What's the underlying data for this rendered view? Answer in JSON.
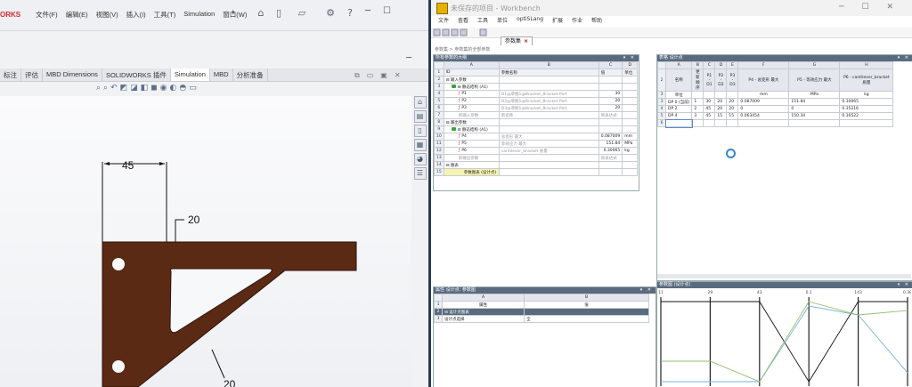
{
  "solidworks": {
    "brand": "ORKS",
    "menu": [
      "文件(F)",
      "编辑(E)",
      "视图(V)",
      "插入(I)",
      "工具(T)",
      "Simulation",
      "窗口(W)"
    ],
    "tabs": [
      "标注",
      "评估",
      "MBD Dimensions",
      "SOLIDWORKS 插件",
      "Simulation",
      "MBD",
      "分析准备"
    ],
    "active_tab": "Simulation",
    "dimensions": {
      "top_width": "45",
      "thickness_top": "20",
      "thickness_bottom": "20"
    },
    "part_color": "#5a2a14"
  },
  "workbench": {
    "title": "未保存的项目 - Workbench",
    "menu": [
      "文件",
      "查看",
      "工具",
      "单位",
      "optiSLang",
      "扩展",
      "作业",
      "帮助"
    ],
    "active_tab": "参数集",
    "breadcrumb": "参数集 > 参数集的全部参数",
    "outline": {
      "title": "所有参数的大纲",
      "col_letters": [
        "A",
        "B",
        "C",
        "D"
      ],
      "rows": [
        {
          "n": "1",
          "a": "ID",
          "b": "参数名称",
          "c": "值",
          "d": "单位"
        },
        {
          "n": "2",
          "a": "⊟  输入参数",
          "b": "",
          "c": "",
          "d": ""
        },
        {
          "n": "3",
          "a": "⊟  静态结构 (A1)",
          "b": "",
          "c": "",
          "d": "",
          "folder": true
        },
        {
          "n": "4",
          "a": "P1",
          "b": "D1@草图1@Bracket_Bracket.Part",
          "c": "30",
          "d": "",
          "param": true
        },
        {
          "n": "5",
          "a": "P2",
          "b": "D2@草图1@Bracket_Bracket.Part",
          "c": "20",
          "d": "",
          "param": true
        },
        {
          "n": "6",
          "a": "P3",
          "b": "D3@草图1@Bracket_Bracket.Part",
          "c": "20",
          "d": "",
          "param": true
        },
        {
          "n": "7",
          "a": "新输入参数",
          "b": "新名称",
          "c": "新表达式",
          "d": "",
          "new": true
        },
        {
          "n": "8",
          "a": "⊟  输出参数",
          "b": "",
          "c": "",
          "d": ""
        },
        {
          "n": "9",
          "a": "⊟  静态结构 (A1)",
          "b": "",
          "c": "",
          "d": "",
          "folder": true
        },
        {
          "n": "10",
          "a": "P4",
          "b": "总变形 最大",
          "c": "0.087009",
          "d": "mm",
          "param": true
        },
        {
          "n": "11",
          "a": "P5",
          "b": "等效应力 最大",
          "c": "151.84",
          "d": "MPa",
          "param": true
        },
        {
          "n": "12",
          "a": "P6",
          "b": "cantilever_bracket 质量",
          "c": "0.30065",
          "d": "kg",
          "param": true
        },
        {
          "n": "13",
          "a": "新输出参数",
          "b": "",
          "c": "新表达式",
          "d": "",
          "new": true
        },
        {
          "n": "14",
          "a": "⊟  图表",
          "b": "",
          "c": "",
          "d": ""
        },
        {
          "n": "15",
          "a": "参数图表 (设计点)",
          "b": "",
          "c": "",
          "d": ""
        }
      ]
    },
    "design_points": {
      "title": "表格 设计点",
      "col_letters": [
        "A",
        "B",
        "C",
        "D",
        "E",
        "F",
        "G",
        "H"
      ],
      "header": [
        "名称",
        "更新顺序",
        "P1 - D1",
        "P2 - D2",
        "P3 - D3",
        "P4 - 总变形 最大",
        "P5 - 等效应力 最大",
        "P6 - cantilever_bracket 质量"
      ],
      "units": [
        "单位",
        "",
        "",
        "",
        "",
        "mm",
        "MPa",
        "kg"
      ],
      "rows": [
        {
          "n": "3",
          "cells": [
            "DP 0 (当前)",
            "1",
            "30",
            "20",
            "20",
            "0.087009",
            "151.84",
            "0.30065"
          ]
        },
        {
          "n": "4",
          "cells": [
            "DP 2",
            "2",
            "45",
            "20",
            "20",
            "0",
            "0",
            "0.35216"
          ]
        },
        {
          "n": "5",
          "cells": [
            "DP 4",
            "3",
            "45",
            "15",
            "15",
            "0.063454",
            "150.34",
            "0.30522"
          ]
        },
        {
          "n": "6",
          "cells": [
            "",
            "",
            "",
            "",
            "",
            "",
            "",
            ""
          ]
        }
      ]
    },
    "props": {
      "title": "属性 设计点: 参数图",
      "col_letters": [
        "A",
        "B"
      ],
      "rows": [
        {
          "n": "1",
          "a": "属性",
          "b": "值"
        },
        {
          "n": "2",
          "a": "⊟  设计点图表",
          "b": ""
        },
        {
          "n": "3",
          "a": "设计点选择",
          "b": "全"
        }
      ]
    },
    "chart": {
      "title": "参数图 (设计点)",
      "axis_ticks": [
        "11",
        "29",
        "43",
        "0.1",
        "143",
        "0.38"
      ]
    }
  }
}
